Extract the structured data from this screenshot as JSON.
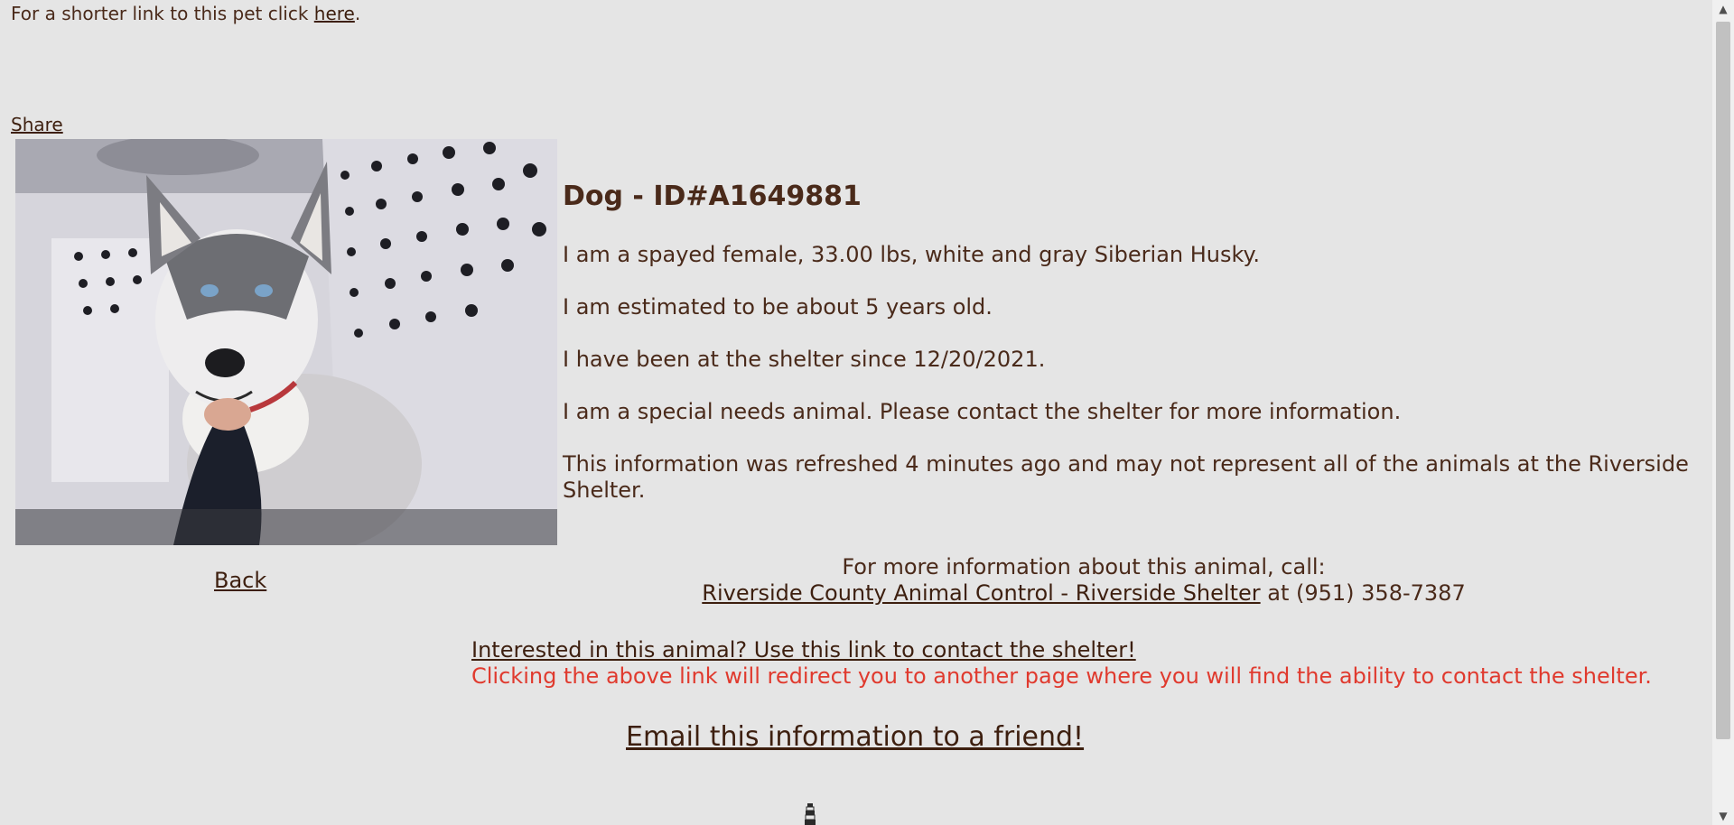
{
  "top_note": {
    "prefix": "For a shorter link to this pet click ",
    "link_label": "here",
    "suffix": "."
  },
  "share_label": "Share",
  "pet": {
    "title": "Dog - ID#A1649881",
    "description": "I am a spayed female, 33.00 lbs, white and gray Siberian Husky.",
    "age": "I am estimated to be about 5 years old.",
    "since": "I have been at the shelter since 12/20/2021.",
    "special_needs": "I am a special needs animal. Please contact the shelter for more information.",
    "refresh_note": "This information was refreshed 4 minutes ago and may not represent all of the animals at the Riverside Shelter."
  },
  "back_label": "Back",
  "contact": {
    "intro": "For more information about this animal, call:",
    "shelter_name": "Riverside County Animal Control - Riverside Shelter",
    "phone_text": " at (951) 358-7387"
  },
  "interest": {
    "link_label": "Interested in this animal? Use this link to contact the shelter!",
    "redirect_note": "Clicking the above link will redirect you to another page where you will find the ability to contact the shelter."
  },
  "email_label": "Email this information to a friend!",
  "colors": {
    "background": "#e5e5e5",
    "text": "#4a2a1a",
    "link": "#3d1f0f",
    "warning": "#e03a2e"
  },
  "icons": {
    "photo": "husky-photo",
    "bottom": "lighthouse-icon",
    "scroll_up": "chevron-up-icon",
    "scroll_down": "chevron-down-icon"
  }
}
